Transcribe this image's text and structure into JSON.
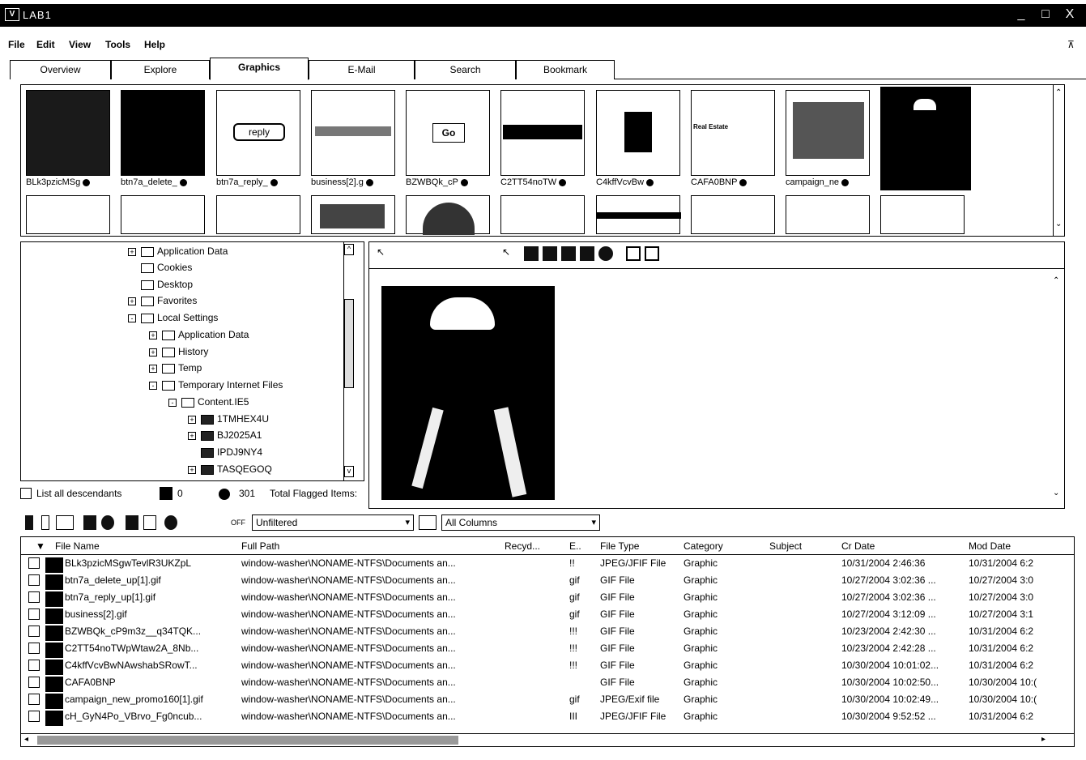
{
  "window": {
    "title": "LAB1",
    "logo": "V"
  },
  "titlebar_buttons": {
    "minimize": "_",
    "maximize": "□",
    "close": "X"
  },
  "menu": [
    "File",
    "Edit",
    "View",
    "Tools",
    "Help"
  ],
  "tabs": [
    "Overview",
    "Explore",
    "Graphics",
    "E-Mail",
    "Search",
    "Bookmark"
  ],
  "active_tab": "Graphics",
  "thumbnails": [
    {
      "label": "BLk3pzicMSg",
      "content": ""
    },
    {
      "label": "btn7a_delete_",
      "content": ""
    },
    {
      "label": "btn7a_reply_",
      "content": "reply"
    },
    {
      "label": "business[2].g",
      "content": ""
    },
    {
      "label": "BZWBQk_cP",
      "content": "Go"
    },
    {
      "label": "C2TT54noTW",
      "content": ""
    },
    {
      "label": "C4kffVcvBw",
      "content": ""
    },
    {
      "label": "CAFA0BNP",
      "content": "Real Estate"
    },
    {
      "label": "campaign_ne",
      "content": ""
    }
  ],
  "tree": [
    {
      "label": "Application Data",
      "level": 0,
      "exp": "+"
    },
    {
      "label": "Cookies",
      "level": 0,
      "exp": ""
    },
    {
      "label": "Desktop",
      "level": 0,
      "exp": ""
    },
    {
      "label": "Favorites",
      "level": 0,
      "exp": "+"
    },
    {
      "label": "Local Settings",
      "level": 0,
      "exp": "-"
    },
    {
      "label": "Application Data",
      "level": 1,
      "exp": "+"
    },
    {
      "label": "History",
      "level": 1,
      "exp": "+"
    },
    {
      "label": "Temp",
      "level": 1,
      "exp": "+"
    },
    {
      "label": "Temporary Internet Files",
      "level": 1,
      "exp": "-"
    },
    {
      "label": "Content.IE5",
      "level": 2,
      "exp": "-"
    },
    {
      "label": "1TMHEX4U",
      "level": 3,
      "exp": "+"
    },
    {
      "label": "BJ2025A1",
      "level": 3,
      "exp": "+"
    },
    {
      "label": "IPDJ9NY4",
      "level": 3,
      "exp": ""
    },
    {
      "label": "TASQEGOQ",
      "level": 3,
      "exp": "+"
    }
  ],
  "tree_footer": {
    "list_all": "List all descendants",
    "count0": "0",
    "count301": "301",
    "flagged": "Total Flagged Items:"
  },
  "filter": {
    "state": "OFF",
    "value": "Unfiltered",
    "columns": "All Columns"
  },
  "grid": {
    "headers": [
      "File Name",
      "Full Path",
      "Recyd...",
      "E..",
      "File Type",
      "Category",
      "Subject",
      "Cr Date",
      "Mod Date"
    ],
    "rows": [
      [
        "BLk3pzicMSgwTevlR3UKZpL",
        "window-washer\\NONAME-NTFS\\Documents an...",
        "",
        "!!",
        "JPEG/JFIF File",
        "Graphic",
        "",
        "10/31/2004 2:46:36",
        "10/31/2004 6:2"
      ],
      [
        "btn7a_delete_up[1].gif",
        "window-washer\\NONAME-NTFS\\Documents an...",
        "",
        "gif",
        "GIF File",
        "Graphic",
        "",
        "10/27/2004 3:02:36 ...",
        "10/27/2004 3:0"
      ],
      [
        "btn7a_reply_up[1].gif",
        "window-washer\\NONAME-NTFS\\Documents an...",
        "",
        "gif",
        "GIF File",
        "Graphic",
        "",
        "10/27/2004 3:02:36 ...",
        "10/27/2004 3:0"
      ],
      [
        "business[2].gif",
        "window-washer\\NONAME-NTFS\\Documents an...",
        "",
        "gif",
        "GIF File",
        "Graphic",
        "",
        "10/27/2004 3:12:09 ...",
        "10/27/2004 3:1"
      ],
      [
        "BZWBQk_cP9m3z__q34TQK...",
        "window-washer\\NONAME-NTFS\\Documents an...",
        "",
        "!!!",
        "GIF File",
        "Graphic",
        "",
        "10/23/2004 2:42:30 ...",
        "10/31/2004 6:2"
      ],
      [
        "C2TT54noTWpWtaw2A_8Nb...",
        "window-washer\\NONAME-NTFS\\Documents an...",
        "",
        "!!!",
        "GIF File",
        "Graphic",
        "",
        "10/23/2004 2:42:28 ...",
        "10/31/2004 6:2"
      ],
      [
        "C4kffVcvBwNAwshabSRowT...",
        "window-washer\\NONAME-NTFS\\Documents an...",
        "",
        "!!!",
        "GIF File",
        "Graphic",
        "",
        "10/30/2004 10:01:02...",
        "10/31/2004 6:2"
      ],
      [
        "CAFA0BNP",
        "window-washer\\NONAME-NTFS\\Documents an...",
        "",
        "",
        "GIF File",
        "Graphic",
        "",
        "10/30/2004 10:02:50...",
        "10/30/2004 10:("
      ],
      [
        "campaign_new_promo160[1].gif",
        "window-washer\\NONAME-NTFS\\Documents an...",
        "",
        "gif",
        "JPEG/Exif file",
        "Graphic",
        "",
        "10/30/2004 10:02:49...",
        "10/30/2004 10:("
      ],
      [
        "cH_GyN4Po_VBrvo_Fg0ncub...",
        "window-washer\\NONAME-NTFS\\Documents an...",
        "",
        "III",
        "JPEG/JFIF File",
        "Graphic",
        "",
        "10/30/2004 9:52:52 ...",
        "10/31/2004 6:2"
      ]
    ]
  },
  "colors": {
    "black": "#000000",
    "white": "#ffffff"
  }
}
